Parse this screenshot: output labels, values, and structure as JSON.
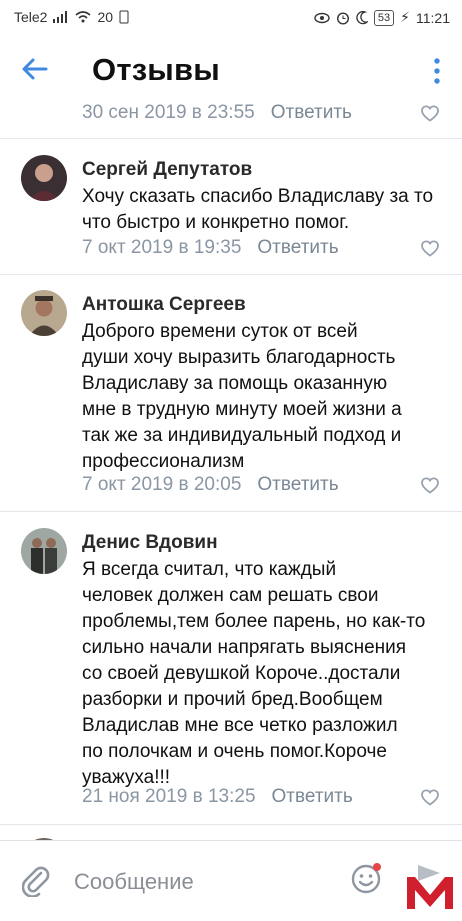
{
  "status_bar": {
    "carrier": "Tele2",
    "network": "20",
    "battery": "53",
    "time": "11:21"
  },
  "header": {
    "title": "Отзывы"
  },
  "top_partial": {
    "date": "30 сен 2019 в 23:55",
    "reply": "Ответить"
  },
  "comments": [
    {
      "name": "Сергей Депутатов",
      "text": "Хочу сказать спасибо Владиславу за то\nчто быстро и конкретно помог.",
      "date": "7 окт 2019 в 19:35",
      "reply": "Ответить"
    },
    {
      "name": "Антошка Сергеев",
      "text": "Доброго времени суток от всей\nдуши хочу выразить благодарность\nВладиславу за помощь оказанную\nмне в трудную минуту моей жизни а\nтак же за индивидуальный подход и\nпрофессионализм",
      "date": "7 окт 2019 в 20:05",
      "reply": "Ответить"
    },
    {
      "name": "Денис Вдовин",
      "text": "Я всегда считал, что каждый\nчеловек должен сам решать свои\nпроблемы,тем более парень, но как-то\nсильно начали напрягать выяснения\nсо своей девушкой Короче..достали\nразборки и прочий бред.Вообщем\nВладислав мне все четко разложил\nпо полочкам и очень помог.Короче\nуважуха!!!",
      "date": "21 ноя 2019 в 13:25",
      "reply": "Ответить"
    }
  ],
  "composer": {
    "placeholder": "Сообщение"
  },
  "colors": {
    "accent": "#3f8ae0",
    "meta": "#8a96a3",
    "logo_red": "#d0202e"
  },
  "icons": [
    "back-arrow-icon",
    "more-vertical-icon",
    "heart-icon",
    "paperclip-icon",
    "smiley-icon"
  ]
}
